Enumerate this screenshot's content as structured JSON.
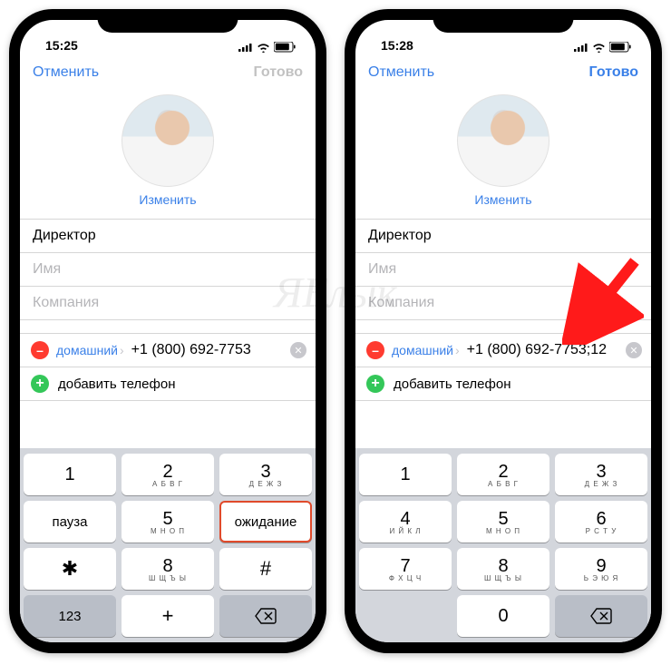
{
  "watermark": "ЯБлык",
  "phones": [
    {
      "time": "15:25",
      "cancel": "Отменить",
      "done": "Готово",
      "done_enabled": false,
      "change": "Изменить",
      "surname": "Директор",
      "name_ph": "Имя",
      "company_ph": "Компания",
      "phone_label": "домашний",
      "phone_value": "+1 (800) 692-7753",
      "add_phone": "добавить телефон",
      "keypad_mode": "alt",
      "keys": [
        {
          "n": "1",
          "s": ""
        },
        {
          "n": "2",
          "s": "А Б В Г"
        },
        {
          "n": "3",
          "s": "Д Е Ж З"
        },
        {
          "t": "пауза"
        },
        {
          "n": "5",
          "s": "М Н О П"
        },
        {
          "t": "ожидание",
          "hl": true
        },
        {
          "sym": "✱"
        },
        {
          "n": "8",
          "s": "Ш Щ Ъ Ы"
        },
        {
          "sym": "#"
        },
        {
          "gray": true,
          "t": "123"
        },
        {
          "sym": "+"
        },
        {
          "gray": true,
          "del": true
        }
      ]
    },
    {
      "time": "15:28",
      "cancel": "Отменить",
      "done": "Готово",
      "done_enabled": true,
      "change": "Изменить",
      "surname": "Директор",
      "name_ph": "Имя",
      "company_ph": "Компания",
      "phone_label": "домашний",
      "phone_value": "+1 (800) 692-7753;12",
      "add_phone": "добавить телефон",
      "keypad_mode": "digits",
      "keys": [
        {
          "n": "1",
          "s": ""
        },
        {
          "n": "2",
          "s": "А Б В Г"
        },
        {
          "n": "3",
          "s": "Д Е Ж З"
        },
        {
          "n": "4",
          "s": "И Й К Л"
        },
        {
          "n": "5",
          "s": "М Н О П"
        },
        {
          "n": "6",
          "s": "Р С Т У"
        },
        {
          "n": "7",
          "s": "Ф Х Ц Ч"
        },
        {
          "n": "8",
          "s": "Ш Щ Ъ Ы"
        },
        {
          "n": "9",
          "s": "Ь Э Ю Я"
        },
        {
          "gray": true,
          "empty": true
        },
        {
          "n": "0",
          "s": ""
        },
        {
          "gray": true,
          "del": true
        }
      ]
    }
  ]
}
